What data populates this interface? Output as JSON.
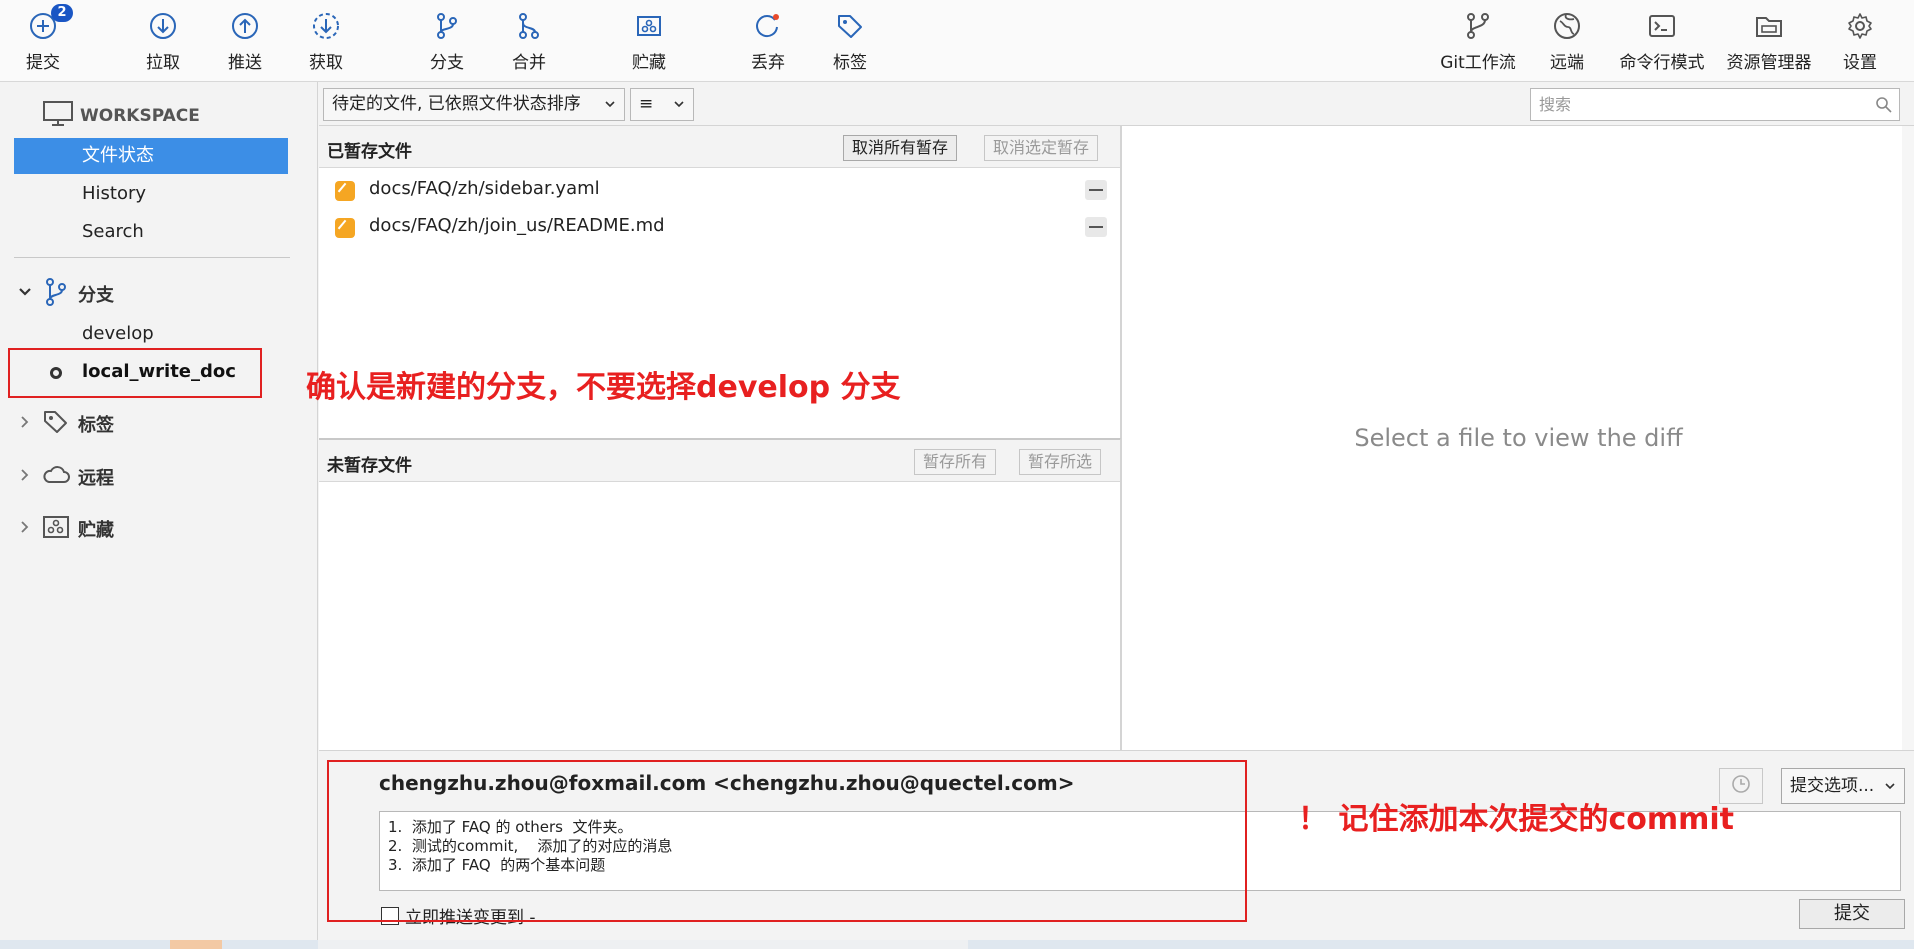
{
  "toolbar": {
    "buttons": [
      {
        "label": "提交",
        "icon": "plus-circle-icon",
        "badge": "2"
      },
      {
        "label": "拉取",
        "icon": "arrow-down-circle-icon"
      },
      {
        "label": "推送",
        "icon": "arrow-up-circle-icon"
      },
      {
        "label": "获取",
        "icon": "fetch-dashed-circle-icon"
      },
      {
        "label": "分支",
        "icon": "branch-icon"
      },
      {
        "label": "合并",
        "icon": "merge-icon"
      },
      {
        "label": "贮藏",
        "icon": "stash-icon"
      },
      {
        "label": "丢弃",
        "icon": "discard-icon"
      },
      {
        "label": "标签",
        "icon": "tag-icon"
      },
      {
        "label": "Git工作流",
        "icon": "git-flow-icon"
      },
      {
        "label": "远端",
        "icon": "globe-icon"
      },
      {
        "label": "命令行模式",
        "icon": "terminal-icon"
      },
      {
        "label": "资源管理器",
        "icon": "folder-icon"
      },
      {
        "label": "设置",
        "icon": "gear-icon"
      }
    ]
  },
  "sidebar": {
    "workspace_title": "WORKSPACE",
    "workspace_items": [
      "文件状态",
      "History",
      "Search"
    ],
    "selected_item": "文件状态",
    "branches_title": "分支",
    "branches": [
      "develop",
      "local_write_doc"
    ],
    "current_branch": "local_write_doc",
    "tags_title": "标签",
    "remotes_title": "远程",
    "stashes_title": "贮藏"
  },
  "filter": {
    "sort_label": "待定的文件, 已依照文件状态排序",
    "view_icon": "≡",
    "search_placeholder": "搜索"
  },
  "staged": {
    "title": "已暂存文件",
    "unstage_all": "取消所有暂存",
    "unstage_selected": "取消选定暂存",
    "files": [
      "docs/FAQ/zh/sidebar.yaml",
      "docs/FAQ/zh/join_us/README.md"
    ]
  },
  "unstaged": {
    "title": "未暂存文件",
    "stage_all": "暂存所有",
    "stage_selected": "暂存所选",
    "files": []
  },
  "diff": {
    "empty_message": "Select a file to view the diff"
  },
  "commit": {
    "author": "chengzhu.zhou@foxmail.com <chengzhu.zhou@quectel.com>",
    "message_lines": [
      "1.  添加了 FAQ 的 others  文件夹。",
      "2.  测试的commit,    添加了的对应的消息",
      "3.  添加了 FAQ  的两个基本问题"
    ],
    "push_label": "立即推送变更到 -",
    "push_checked": false,
    "options_label": "提交选项...",
    "commit_label": "提交"
  },
  "annotations": {
    "branch_note": "确认是新建的分支，不要选择develop 分支",
    "commit_note": "！  记住添加本次提交的commit",
    "color": "#e02020"
  }
}
